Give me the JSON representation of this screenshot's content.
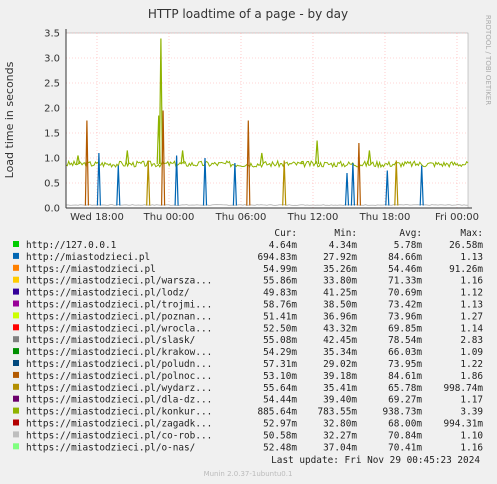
{
  "chart_data": {
    "type": "line",
    "title": "HTTP loadtime of a page - by day",
    "ylabel": "Load time in seconds",
    "side_label": "RRDTOOL / TOBI OETIKER",
    "ylim": [
      0,
      3.5
    ],
    "y_ticks": [
      "0.0",
      "0.5",
      "1.0",
      "1.5",
      "2.0",
      "2.5",
      "3.0",
      "3.5"
    ],
    "x_ticks": [
      "Wed 18:00",
      "Thu 00:00",
      "Thu 06:00",
      "Thu 12:00",
      "Thu 18:00",
      "Fri 00:00"
    ],
    "grid": true,
    "legend_header": [
      "Cur:",
      "Min:",
      "Avg:",
      "Max:"
    ],
    "series": [
      {
        "name": "http://127.0.0.1",
        "color": "#00cc00",
        "cur": "4.64m",
        "min": "4.34m",
        "avg": "5.78m",
        "max": "26.58m"
      },
      {
        "name": "http://miastodzieci.pl",
        "color": "#0066b3",
        "cur": "694.83m",
        "min": "27.92m",
        "avg": "84.66m",
        "max": "1.13"
      },
      {
        "name": "https://miastodzieci.pl",
        "color": "#ff8000",
        "cur": "54.99m",
        "min": "35.26m",
        "avg": "54.46m",
        "max": "91.26m"
      },
      {
        "name": "https://miastodzieci.pl/warsza...",
        "color": "#ffcc00",
        "cur": "55.86m",
        "min": "33.80m",
        "avg": "71.33m",
        "max": "1.16"
      },
      {
        "name": "https://miastodzieci.pl/lodz/",
        "color": "#330099",
        "cur": "49.83m",
        "min": "41.25m",
        "avg": "70.69m",
        "max": "1.12"
      },
      {
        "name": "https://miastodzieci.pl/trojmi...",
        "color": "#990099",
        "cur": "58.76m",
        "min": "38.50m",
        "avg": "73.42m",
        "max": "1.13"
      },
      {
        "name": "https://miastodzieci.pl/poznan...",
        "color": "#ccff00",
        "cur": "51.41m",
        "min": "36.96m",
        "avg": "73.96m",
        "max": "1.27"
      },
      {
        "name": "https://miastodzieci.pl/wrocla...",
        "color": "#ff0000",
        "cur": "52.50m",
        "min": "43.32m",
        "avg": "69.85m",
        "max": "1.14"
      },
      {
        "name": "https://miastodzieci.pl/slask/",
        "color": "#808080",
        "cur": "55.08m",
        "min": "42.45m",
        "avg": "78.54m",
        "max": "2.83"
      },
      {
        "name": "https://miastodzieci.pl/krakow...",
        "color": "#008f00",
        "cur": "54.29m",
        "min": "35.34m",
        "avg": "66.03m",
        "max": "1.09"
      },
      {
        "name": "https://miastodzieci.pl/poludn...",
        "color": "#00487d",
        "cur": "57.31m",
        "min": "29.02m",
        "avg": "73.95m",
        "max": "1.22"
      },
      {
        "name": "https://miastodzieci.pl/polnoc...",
        "color": "#b35a00",
        "cur": "53.10m",
        "min": "39.18m",
        "avg": "84.61m",
        "max": "1.86"
      },
      {
        "name": "https://miastodzieci.pl/wydarz...",
        "color": "#b38f00",
        "cur": "55.64m",
        "min": "35.41m",
        "avg": "65.78m",
        "max": "998.74m"
      },
      {
        "name": "https://miastodzieci.pl/dla-dz...",
        "color": "#6b006b",
        "cur": "54.44m",
        "min": "39.40m",
        "avg": "69.27m",
        "max": "1.17"
      },
      {
        "name": "https://miastodzieci.pl/konkur...",
        "color": "#8fb300",
        "cur": "885.64m",
        "min": "783.55m",
        "avg": "938.73m",
        "max": "3.39"
      },
      {
        "name": "https://miastodzieci.pl/zagadk...",
        "color": "#b30000",
        "cur": "52.97m",
        "min": "32.80m",
        "avg": "68.00m",
        "max": "994.31m"
      },
      {
        "name": "https://miastodzieci.pl/co-rob...",
        "color": "#bebebe",
        "cur": "50.58m",
        "min": "32.27m",
        "avg": "70.84m",
        "max": "1.10"
      },
      {
        "name": "https://miastodzieci.pl/o-nas/",
        "color": "#80ff80",
        "cur": "52.48m",
        "min": "37.04m",
        "avg": "70.41m",
        "max": "1.16"
      }
    ],
    "spikes": [
      {
        "x": 0.8,
        "y": 1.05,
        "color": "#8fb300"
      },
      {
        "x": 1.4,
        "y": 1.75,
        "color": "#b35a00"
      },
      {
        "x": 2.2,
        "y": 1.1,
        "color": "#0066b3"
      },
      {
        "x": 3.5,
        "y": 0.85,
        "color": "#0066b3"
      },
      {
        "x": 4.1,
        "y": 1.15,
        "color": "#8fb300"
      },
      {
        "x": 5.5,
        "y": 0.95,
        "color": "#b38f00"
      },
      {
        "x": 6.2,
        "y": 1.85,
        "color": "#8fb300"
      },
      {
        "x": 6.35,
        "y": 3.39,
        "color": "#8fb300"
      },
      {
        "x": 6.5,
        "y": 1.95,
        "color": "#b35a00"
      },
      {
        "x": 7.4,
        "y": 1.05,
        "color": "#0066b3"
      },
      {
        "x": 7.8,
        "y": 1.15,
        "color": "#8fb300"
      },
      {
        "x": 9.3,
        "y": 1.0,
        "color": "#0066b3"
      },
      {
        "x": 11.3,
        "y": 0.9,
        "color": "#0066b3"
      },
      {
        "x": 12.2,
        "y": 1.75,
        "color": "#b35a00"
      },
      {
        "x": 13.1,
        "y": 1.1,
        "color": "#8fb300"
      },
      {
        "x": 14.6,
        "y": 0.95,
        "color": "#b38f00"
      },
      {
        "x": 15.8,
        "y": 0.9,
        "color": "#8fb300"
      },
      {
        "x": 16.8,
        "y": 1.35,
        "color": "#8fb300"
      },
      {
        "x": 18.8,
        "y": 0.7,
        "color": "#0066b3"
      },
      {
        "x": 19.2,
        "y": 0.9,
        "color": "#0066b3"
      },
      {
        "x": 19.6,
        "y": 1.3,
        "color": "#b35a00"
      },
      {
        "x": 20.3,
        "y": 1.15,
        "color": "#8fb300"
      },
      {
        "x": 21.5,
        "y": 0.75,
        "color": "#0066b3"
      },
      {
        "x": 22.1,
        "y": 0.95,
        "color": "#b38f00"
      },
      {
        "x": 23.8,
        "y": 0.85,
        "color": "#0066b3"
      }
    ]
  },
  "footer": {
    "last_update": "Last update: Fri Nov 29 00:45:23 2024",
    "munin": "Munin 2.0.37-1ubuntu0.1"
  }
}
